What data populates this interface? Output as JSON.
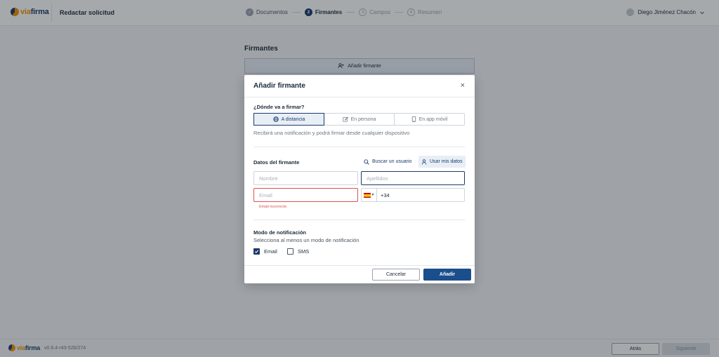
{
  "app": {
    "logo_text_accent": "via",
    "logo_text_main": "firma",
    "page_title": "Redactar solicitud",
    "user_name": "Diego Jiménez Chacón"
  },
  "stepper": [
    {
      "num": "✓",
      "label": "Documentos",
      "state": "done"
    },
    {
      "num": "2",
      "label": "Firmantes",
      "state": "active"
    },
    {
      "num": "3",
      "label": "Campos",
      "state": "todo"
    },
    {
      "num": "4",
      "label": "Resumen",
      "state": "todo"
    }
  ],
  "background": {
    "section_title": "Firmantes",
    "add_signer_bar": "Añadir firmante"
  },
  "footer": {
    "logo_accent": "via",
    "logo_main": "firma",
    "version": "v0.6.4-r43-52b/274",
    "back_label": "Atrás",
    "next_label": "Siguiente"
  },
  "modal": {
    "title": "Añadir firmante",
    "close": "×",
    "where_label": "¿Dónde va a firmar?",
    "where_options": [
      {
        "label": "A distancia",
        "icon": "globe-icon",
        "selected": true
      },
      {
        "label": "En persona",
        "icon": "edit-icon",
        "selected": false
      },
      {
        "label": "En app móvil",
        "icon": "mobile-icon",
        "selected": false
      }
    ],
    "where_hint": "Recibirá una notificación y podrá firmar desde cualquier dispositivo",
    "signer_data_label": "Datos del firmante",
    "search_user": "Buscar un usuario",
    "use_my_data": "Usar mis datos",
    "nombre_placeholder": "Nombre",
    "apellidos_placeholder": "Apellidos",
    "email_placeholder": "Email",
    "phone_prefix": "+34",
    "email_error": "Email incorrecto",
    "notif_label": "Modo de notificación",
    "notif_hint": "Selecciona al menos un modo de notificación",
    "notif_email": "Email",
    "notif_email_checked": true,
    "notif_sms": "SMS",
    "notif_sms_checked": false,
    "cancel_label": "Cancelar",
    "add_label": "Añadir"
  },
  "colors": {
    "brand_blue": "#1b3a6b",
    "brand_orange": "#f39200",
    "primary_button": "#1b4e8c",
    "error": "#d9534f"
  }
}
